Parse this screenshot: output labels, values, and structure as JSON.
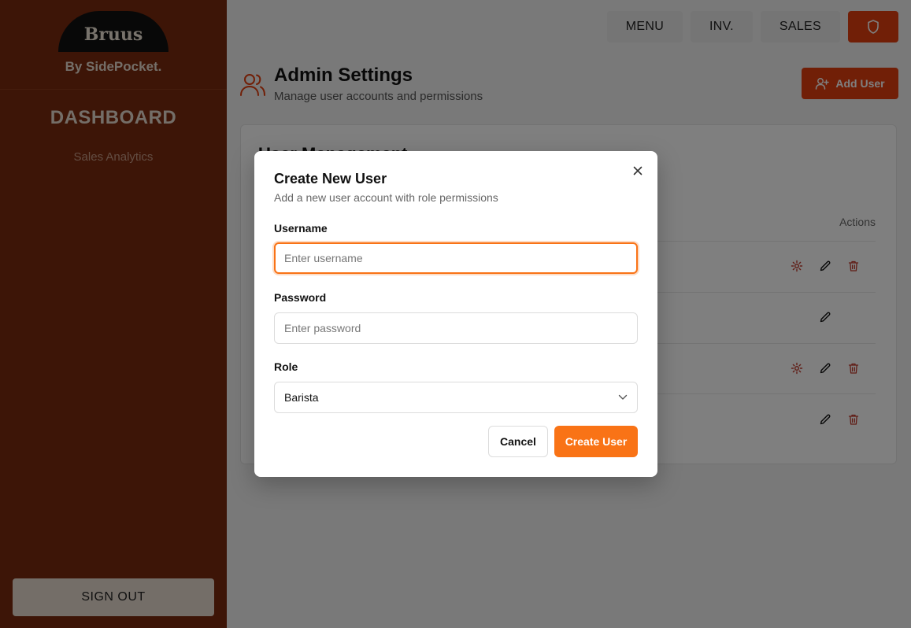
{
  "sidebar": {
    "logo_text": "Bruus",
    "logo_sub": "By SidePocket.",
    "section_title": "DASHBOARD",
    "links": [
      {
        "label": "Sales Analytics"
      }
    ],
    "sign_out_label": "SIGN OUT"
  },
  "topnav": {
    "items": [
      {
        "label": "MENU"
      },
      {
        "label": "INV."
      },
      {
        "label": "SALES"
      }
    ],
    "admin_icon": "shield-icon"
  },
  "header": {
    "title": "Admin Settings",
    "subtitle": "Manage user accounts and permissions",
    "add_user_label": "Add User"
  },
  "card": {
    "title": "User Management",
    "actions_header": "Actions"
  },
  "modal": {
    "title": "Create New User",
    "description": "Add a new user account with role permissions",
    "username_label": "Username",
    "username_placeholder": "Enter username",
    "password_label": "Password",
    "password_placeholder": "Enter password",
    "role_label": "Role",
    "role_value": "Barista",
    "cancel_label": "Cancel",
    "create_label": "Create User"
  },
  "colors": {
    "sidebar": "#7a2a0e",
    "accent": "#e23f0f",
    "primary_button": "#f97316"
  }
}
